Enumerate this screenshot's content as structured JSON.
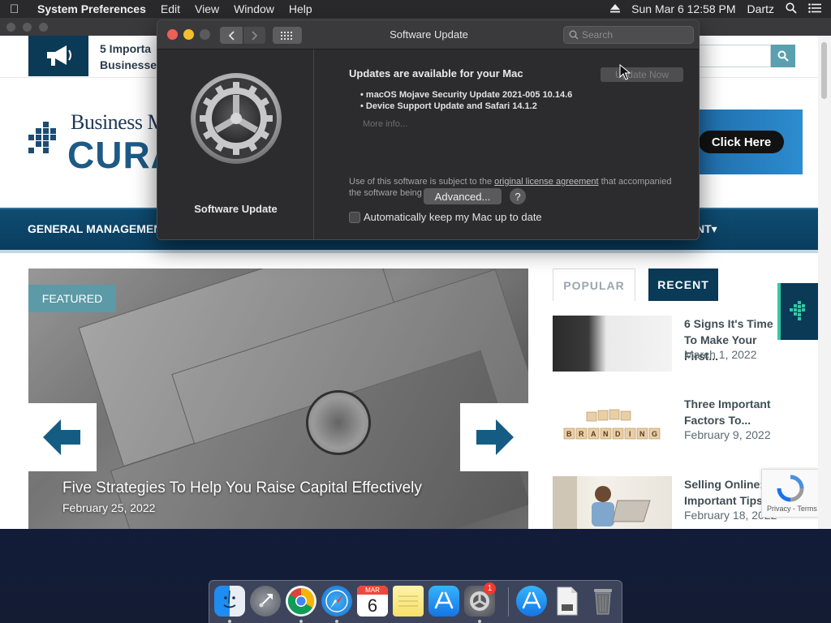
{
  "menubar": {
    "app_name": "System Preferences",
    "menus": [
      "Edit",
      "View",
      "Window",
      "Help"
    ],
    "clock": "Sun Mar 6  12:58 PM",
    "user": "Dartz"
  },
  "website": {
    "topbar_text": "5 Importa",
    "topbar_text2": "Businesse",
    "logo_top": "Business Ma",
    "logo_big": "CURAT",
    "banner_button": "Click Here",
    "nav_left": "GENERAL MANAGEMENT",
    "nav_right": "NT",
    "featured_tag": "FEATURED",
    "slide_title": "Five Strategies To Help You Raise Capital Effectively",
    "slide_date": "February 25, 2022",
    "tab_popular": "POPULAR",
    "tab_recent": "RECENT",
    "posts": [
      {
        "title": "6 Signs It's Time To Make Your First...",
        "date": "March 1, 2022"
      },
      {
        "title": "Three Important Factors To...",
        "date": "February 9, 2022"
      },
      {
        "title": "Selling Online: 3 Important Tips",
        "date": "February 18, 2022"
      }
    ],
    "branding_text": "BRANDING",
    "recaptcha_text": "Privacy - Terms"
  },
  "software_update": {
    "window_title": "Software Update",
    "search_placeholder": "Search",
    "pane_label": "Software Update",
    "heading": "Updates are available for your Mac",
    "update_now": "Update Now",
    "items": [
      "• macOS Mojave Security Update 2021-005 10.14.6",
      "• Device Support Update  and Safari 14.1.2"
    ],
    "more_info": "More info...",
    "license_pre": "Use of this software is subject to the ",
    "license_link": "original license agreement",
    "license_post": " that accompanied the software being updated.",
    "auto_update_label": "Automatically keep my Mac up to date",
    "advanced_button": "Advanced...",
    "help_button": "?"
  },
  "dock": {
    "calendar_month": "MAR",
    "calendar_day": "6",
    "sysprefs_badge": "1"
  }
}
